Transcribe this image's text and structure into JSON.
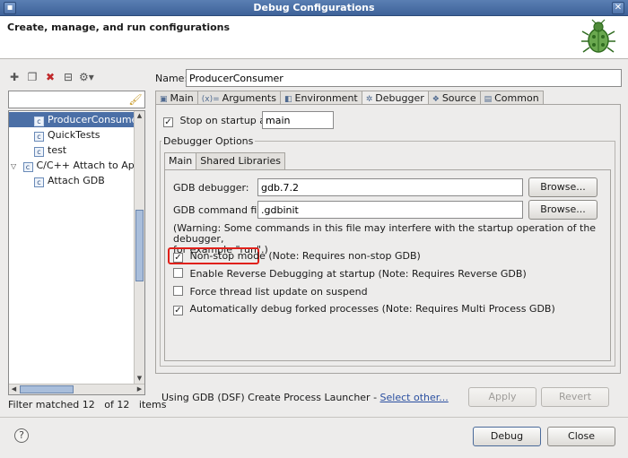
{
  "window": {
    "title": "Debug Configurations"
  },
  "header": {
    "title": "Create, manage, and run configurations"
  },
  "left": {
    "filter_placeholder": "",
    "tree": [
      {
        "label": "ProducerConsumer",
        "selected": true,
        "level": 1,
        "icon": "c-config-icon"
      },
      {
        "label": "QuickTests",
        "selected": false,
        "level": 1,
        "icon": "c-config-icon"
      },
      {
        "label": "test",
        "selected": false,
        "level": 1,
        "icon": "c-config-icon"
      },
      {
        "label": "C/C++ Attach to Applic",
        "selected": false,
        "level": 0,
        "icon": "attach-type-icon",
        "expanded": true
      },
      {
        "label": "Attach GDB",
        "selected": false,
        "level": 1,
        "icon": "c-config-icon"
      }
    ],
    "status": {
      "part1": "Filter matched 12",
      "part2": "of 12",
      "part3": "items"
    }
  },
  "config": {
    "name_label": "Name:",
    "name_value": "ProducerConsumer",
    "tabs": [
      "Main",
      "Arguments",
      "Environment",
      "Debugger",
      "Source",
      "Common"
    ],
    "tab_icons": [
      "main-tab-icon",
      "arguments-tab-icon",
      "environment-tab-icon",
      "debugger-tab-icon",
      "source-tab-icon",
      "common-tab-icon"
    ],
    "active_tab": "Debugger",
    "stop_on_startup_label": "Stop on startup at:",
    "stop_on_startup_checked": true,
    "stop_on_startup_value": "main",
    "debugger_options_label": "Debugger Options",
    "subtabs": [
      "Main",
      "Shared Libraries"
    ],
    "gdb_debugger_label": "GDB debugger:",
    "gdb_debugger_value": "gdb.7.2",
    "gdb_command_file_label": "GDB command file:",
    "gdb_command_file_value": ".gdbinit",
    "browse_label": "Browse...",
    "warning_line1": "(Warning: Some commands in this file may interfere with the startup operation of the debugger,",
    "warning_line2": "for example \"run\".)",
    "options": [
      {
        "label": "Non-stop mode",
        "suffix": "(Note: Requires non-stop GDB)",
        "checked": true
      },
      {
        "label": "Enable Reverse Debugging at startup (Note: Requires Reverse GDB)",
        "suffix": "",
        "checked": false
      },
      {
        "label": "Force thread list update on suspend",
        "suffix": "",
        "checked": false
      },
      {
        "label": "Automatically debug forked processes (Note: Requires Multi Process GDB)",
        "suffix": "",
        "checked": true
      }
    ],
    "launcher_text": "Using GDB (DSF) Create Process Launcher - ",
    "launcher_link": "Select other...",
    "apply_label": "Apply",
    "revert_label": "Revert"
  },
  "footer": {
    "help_label": "?",
    "debug_label": "Debug",
    "close_label": "Close"
  },
  "colors": {
    "highlight_box": "#e0201a",
    "selection": "#4b6fa6"
  }
}
